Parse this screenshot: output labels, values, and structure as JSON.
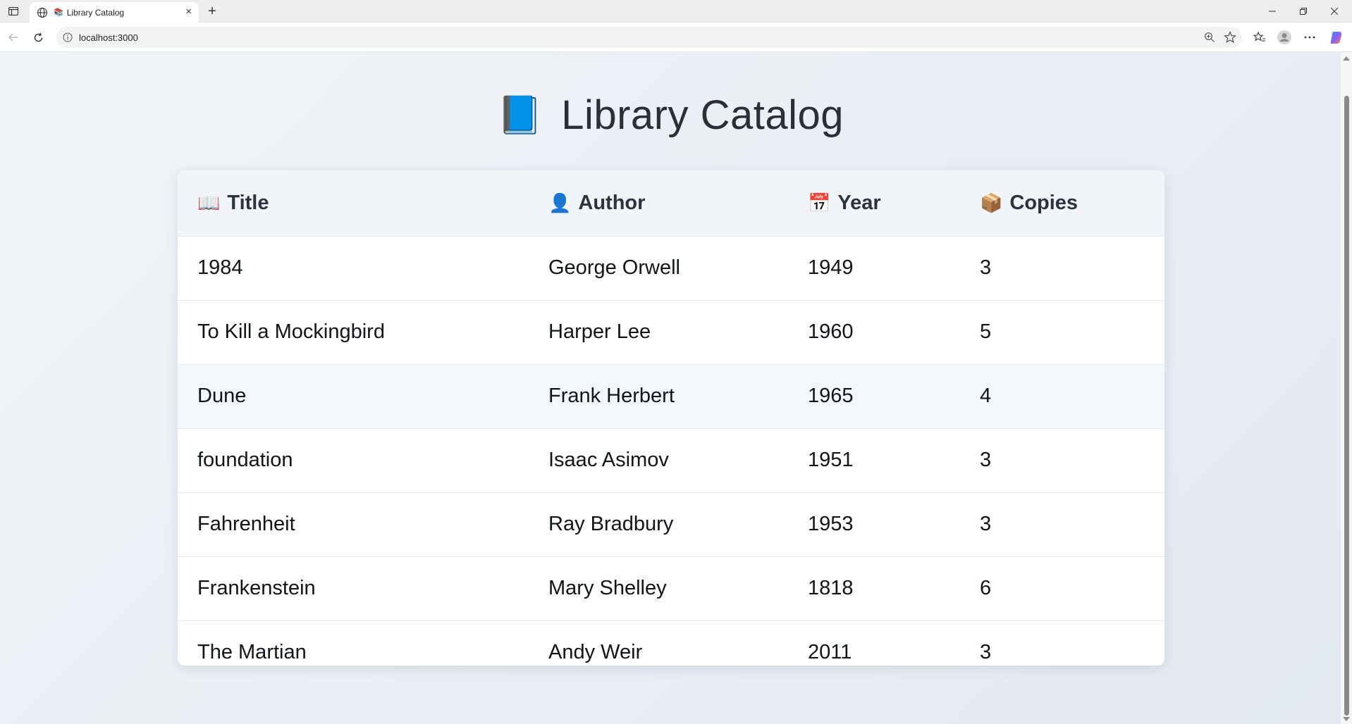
{
  "browser": {
    "tab_title": "Library Catalog",
    "tab_favicon": "📚",
    "url": "localhost:3000",
    "new_tab_label": "+",
    "close_label": "×"
  },
  "page": {
    "title_icon": "📘",
    "title": "Library Catalog"
  },
  "table": {
    "headers": [
      {
        "icon": "📖",
        "label": "Title"
      },
      {
        "icon": "👤",
        "label": "Author"
      },
      {
        "icon": "📅",
        "label": "Year"
      },
      {
        "icon": "📦",
        "label": "Copies"
      }
    ],
    "rows": [
      {
        "title": "1984",
        "author": "George Orwell",
        "year": "1949",
        "copies": "3"
      },
      {
        "title": "To Kill a Mockingbird",
        "author": "Harper Lee",
        "year": "1960",
        "copies": "5"
      },
      {
        "title": "Dune",
        "author": "Frank Herbert",
        "year": "1965",
        "copies": "4"
      },
      {
        "title": "foundation",
        "author": "Isaac Asimov",
        "year": "1951",
        "copies": "3"
      },
      {
        "title": "Fahrenheit",
        "author": "Ray Bradbury",
        "year": "1953",
        "copies": "3"
      },
      {
        "title": "Frankenstein",
        "author": "Mary Shelley",
        "year": "1818",
        "copies": "6"
      },
      {
        "title": "The Martian",
        "author": "Andy Weir",
        "year": "2011",
        "copies": "3"
      }
    ]
  }
}
